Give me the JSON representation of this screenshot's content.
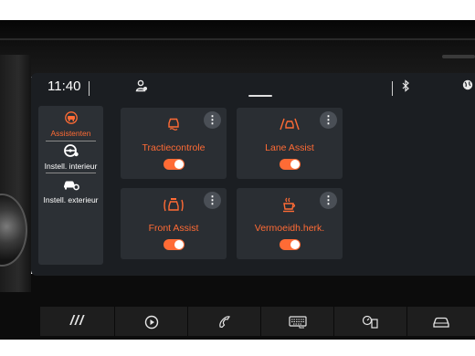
{
  "status": {
    "time": "11:40",
    "user_icon": "person-icon",
    "bt_icon": "bluetooth-icon",
    "globe_icon": "globe-icon"
  },
  "sidebar": {
    "items": [
      {
        "label": "Assistenten",
        "icon": "car-assist-icon",
        "active": true
      },
      {
        "label": "Instell. interieur",
        "icon": "steering-wheel-icon",
        "active": false
      },
      {
        "label": "Instell. exterieur",
        "icon": "car-gear-icon",
        "active": false
      }
    ]
  },
  "cards": [
    {
      "label": "Tractiecontrole",
      "icon": "traction-control-icon",
      "enabled": true
    },
    {
      "label": "Lane Assist",
      "icon": "lane-assist-icon",
      "enabled": true
    },
    {
      "label": "Front Assist",
      "icon": "front-assist-icon",
      "enabled": true
    },
    {
      "label": "Vermoeidh.herk.",
      "icon": "coffee-cup-icon",
      "enabled": true
    }
  ],
  "more_glyph": "⋮",
  "bottom_bar": [
    {
      "label": "///",
      "icon": "menu-slash-icon"
    },
    {
      "icon": "play-icon"
    },
    {
      "icon": "phone-icon"
    },
    {
      "icon": "keyboard-icon"
    },
    {
      "icon": "fuel-stats-icon"
    },
    {
      "icon": "car-icon"
    }
  ],
  "colors": {
    "accent": "#ff6b35",
    "screen_bg": "#1b1e22",
    "card_bg": "#2a2e33",
    "text": "#ffffff"
  }
}
